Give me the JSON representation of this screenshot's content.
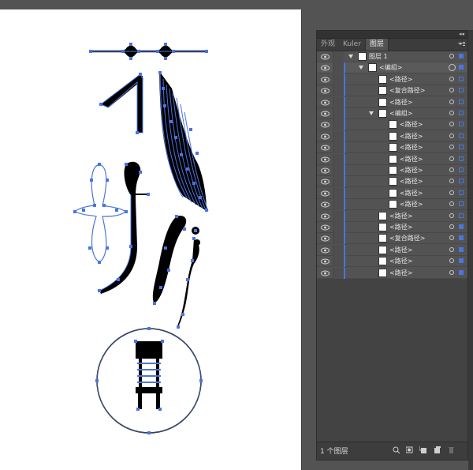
{
  "panel": {
    "tabs": [
      {
        "label": "外观"
      },
      {
        "label": "Kuler"
      },
      {
        "label": "图层"
      }
    ],
    "collapse_icon": "double-chevron-left-icon",
    "menu_icon": "panel-menu-icon",
    "layers": [
      {
        "name": "图层 1",
        "icon": "layer-thumb",
        "expanded": true
      },
      {
        "name": "<编组>",
        "icon": "group-thumb",
        "expanded": true
      },
      {
        "name": "<路径>",
        "icon": "path-thumb"
      },
      {
        "name": "<复合路径>",
        "icon": "compound-path-thumb"
      },
      {
        "name": "<路径>",
        "icon": "path-thumb"
      },
      {
        "name": "<编组>",
        "icon": "group-thumb",
        "expanded": true
      },
      {
        "name": "<路径>",
        "icon": "path-thumb"
      },
      {
        "name": "<路径>",
        "icon": "path-thumb"
      },
      {
        "name": "<路径>",
        "icon": "path-thumb"
      },
      {
        "name": "<路径>",
        "icon": "path-thumb"
      },
      {
        "name": "<路径>",
        "icon": "path-thumb"
      },
      {
        "name": "<路径>",
        "icon": "path-thumb"
      },
      {
        "name": "<路径>",
        "icon": "path-thumb"
      },
      {
        "name": "<路径>",
        "icon": "path-thumb"
      },
      {
        "name": "<路径>",
        "icon": "path-thumb"
      },
      {
        "name": "<路径>",
        "icon": "path-thumb"
      },
      {
        "name": "<复合路径>",
        "icon": "compound-path-thumb"
      },
      {
        "name": "<路径>",
        "icon": "path-thumb"
      },
      {
        "name": "<路径>",
        "icon": "path-thumb"
      },
      {
        "name": "<路径>",
        "icon": "path-thumb"
      }
    ],
    "footer": {
      "count_text": "1 个图层",
      "icons": [
        "locate-object-icon",
        "make-clip-mask-icon",
        "new-sublayer-icon",
        "new-layer-icon",
        "delete-icon"
      ]
    }
  },
  "colors": {
    "selection_blue": "#4a74e0",
    "panel_bg": "#535353",
    "artboard": "#ffffff"
  }
}
